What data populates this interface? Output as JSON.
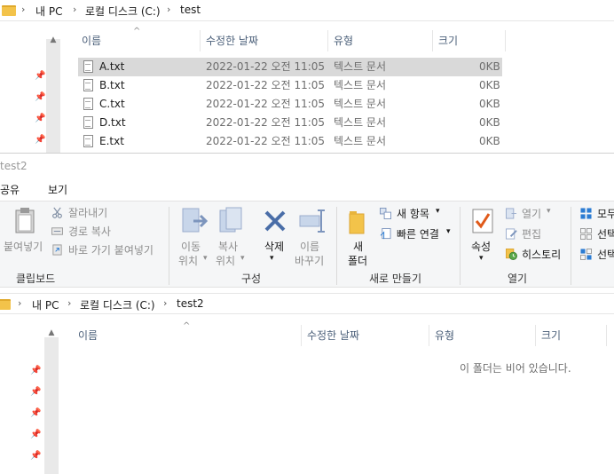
{
  "top_window": {
    "breadcrumb": [
      "내 PC",
      "로컬 디스크 (C:)",
      "test"
    ],
    "columns": [
      "이름",
      "수정한 날짜",
      "유형",
      "크기"
    ],
    "files": [
      {
        "name": "A.txt",
        "date": "2022-01-22 오전 11:05",
        "type": "텍스트 문서",
        "size": "0KB",
        "selected": true
      },
      {
        "name": "B.txt",
        "date": "2022-01-22 오전 11:05",
        "type": "텍스트 문서",
        "size": "0KB",
        "selected": false
      },
      {
        "name": "C.txt",
        "date": "2022-01-22 오전 11:05",
        "type": "텍스트 문서",
        "size": "0KB",
        "selected": false
      },
      {
        "name": "D.txt",
        "date": "2022-01-22 오전 11:05",
        "type": "텍스트 문서",
        "size": "0KB",
        "selected": false
      },
      {
        "name": "E.txt",
        "date": "2022-01-22 오전 11:05",
        "type": "텍스트 문서",
        "size": "0KB",
        "selected": false
      }
    ]
  },
  "bottom_window": {
    "title": "test2",
    "tabs": [
      "공유",
      "보기"
    ],
    "ribbon": {
      "clipboard": {
        "paste": "붙여넣기",
        "cut": "잘라내기",
        "copy_path": "경로 복사",
        "paste_shortcut": "바로 가기 붙여넣기",
        "group": "클립보드"
      },
      "organize": {
        "move_line1": "이동",
        "move_line2": "위치",
        "copy_line1": "복사",
        "copy_line2": "위치",
        "delete": "삭제",
        "rename_line1": "이름",
        "rename_line2": "바꾸기",
        "group": "구성"
      },
      "new": {
        "new_folder_line1": "새",
        "new_folder_line2": "폴더",
        "new_item": "새 항목",
        "easy_access": "빠른 연결",
        "group": "새로 만들기"
      },
      "open": {
        "properties": "속성",
        "open": "열기",
        "edit": "편집",
        "history": "히스토리",
        "group": "열기"
      },
      "select": {
        "select_all_partial": "모두",
        "select_none_partial": "선택",
        "invert_partial": "선택"
      }
    },
    "breadcrumb": [
      "내 PC",
      "로컬 디스크 (C:)",
      "test2"
    ],
    "columns": [
      "이름",
      "수정한 날짜",
      "유형",
      "크기"
    ],
    "empty_message": "이 폴더는 비어 있습니다."
  },
  "colors": {
    "folder": "#f3c34a",
    "selected_row": "#d9d9d9",
    "header_text": "#4c607a",
    "accent_blue": "#2b7cd3",
    "delete_blue": "#4a6ea8"
  }
}
